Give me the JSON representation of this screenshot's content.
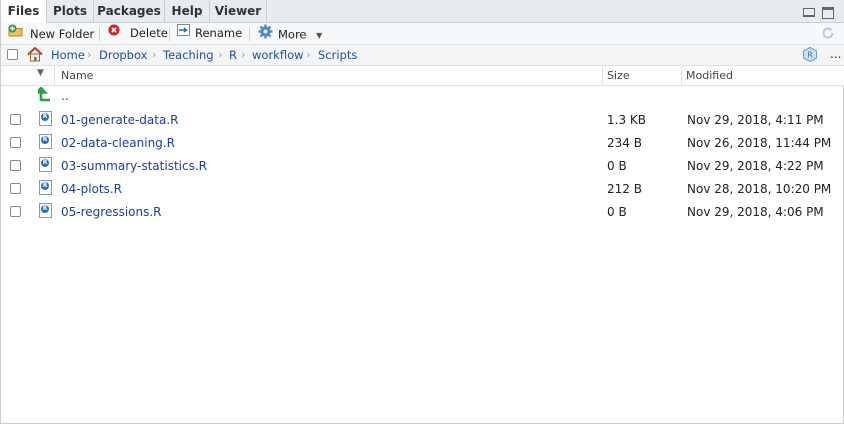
{
  "tabs": [
    {
      "label": "Files",
      "active": true
    },
    {
      "label": "Plots",
      "active": false
    },
    {
      "label": "Packages",
      "active": false
    },
    {
      "label": "Help",
      "active": false
    },
    {
      "label": "Viewer",
      "active": false
    }
  ],
  "toolbar": {
    "new_folder_label": "New Folder",
    "delete_label": "Delete",
    "rename_label": "Rename",
    "more_label": "More"
  },
  "breadcrumb": [
    "Home",
    "Dropbox",
    "Teaching",
    "R",
    "workflow",
    "Scripts"
  ],
  "breadcrumb_more": "...",
  "columns": {
    "name": "Name",
    "size": "Size",
    "modified": "Modified"
  },
  "parent_dir_label": "..",
  "files": [
    {
      "name": "01-generate-data.R",
      "size": "1.3 KB",
      "modified": "Nov 29, 2018, 4:11 PM"
    },
    {
      "name": "02-data-cleaning.R",
      "size": "234 B",
      "modified": "Nov 26, 2018, 11:44 PM"
    },
    {
      "name": "03-summary-statistics.R",
      "size": "0 B",
      "modified": "Nov 29, 2018, 4:22 PM"
    },
    {
      "name": "04-plots.R",
      "size": "212 B",
      "modified": "Nov 28, 2018, 10:20 PM"
    },
    {
      "name": "05-regressions.R",
      "size": "0 B",
      "modified": "Nov 29, 2018, 4:06 PM"
    }
  ],
  "icons": {
    "home": "home-icon",
    "up": "up-arrow-icon",
    "new_folder": "new-folder-icon",
    "delete": "delete-icon",
    "rename": "rename-icon",
    "more": "gear-icon",
    "refresh": "refresh-icon",
    "project": "r-project-icon",
    "r_file": "r-file-icon"
  },
  "colors": {
    "link": "#1a3ea3",
    "accent_green": "#2e9e4a",
    "delete_red": "#c62828"
  }
}
